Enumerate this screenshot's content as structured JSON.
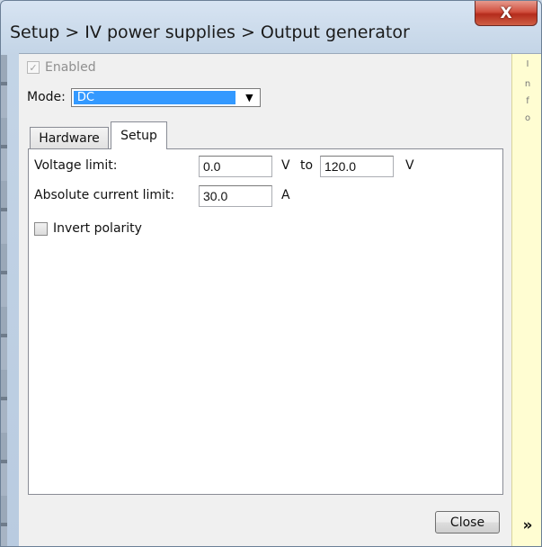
{
  "window": {
    "title": "Setup > IV power supplies > Output generator",
    "close_glyph": "X"
  },
  "enabled": {
    "label": "Enabled",
    "checked": true,
    "check_glyph": "✓"
  },
  "mode": {
    "label": "Mode:",
    "value": "DC",
    "arrow_glyph": "▼"
  },
  "tabs": [
    {
      "label": "Hardware",
      "selected": false
    },
    {
      "label": "Setup",
      "selected": true
    }
  ],
  "setup": {
    "voltage_limit_label": "Voltage limit:",
    "voltage_min": "0.0",
    "voltage_min_unit": "V",
    "to_label": "to",
    "voltage_max": "120.0",
    "voltage_max_unit": "V",
    "current_limit_label": "Absolute current limit:",
    "current_limit": "30.0",
    "current_unit": "A",
    "invert_polarity_label": "Invert polarity",
    "invert_polarity_checked": false
  },
  "footer": {
    "close_label": "Close"
  },
  "info_panel": {
    "letters": [
      "I",
      "n",
      "f",
      "o"
    ],
    "expand_glyph": "»"
  },
  "colors": {
    "selection": "#3399ff",
    "info_background": "#fffdd2",
    "close_x": "#c7402d"
  }
}
